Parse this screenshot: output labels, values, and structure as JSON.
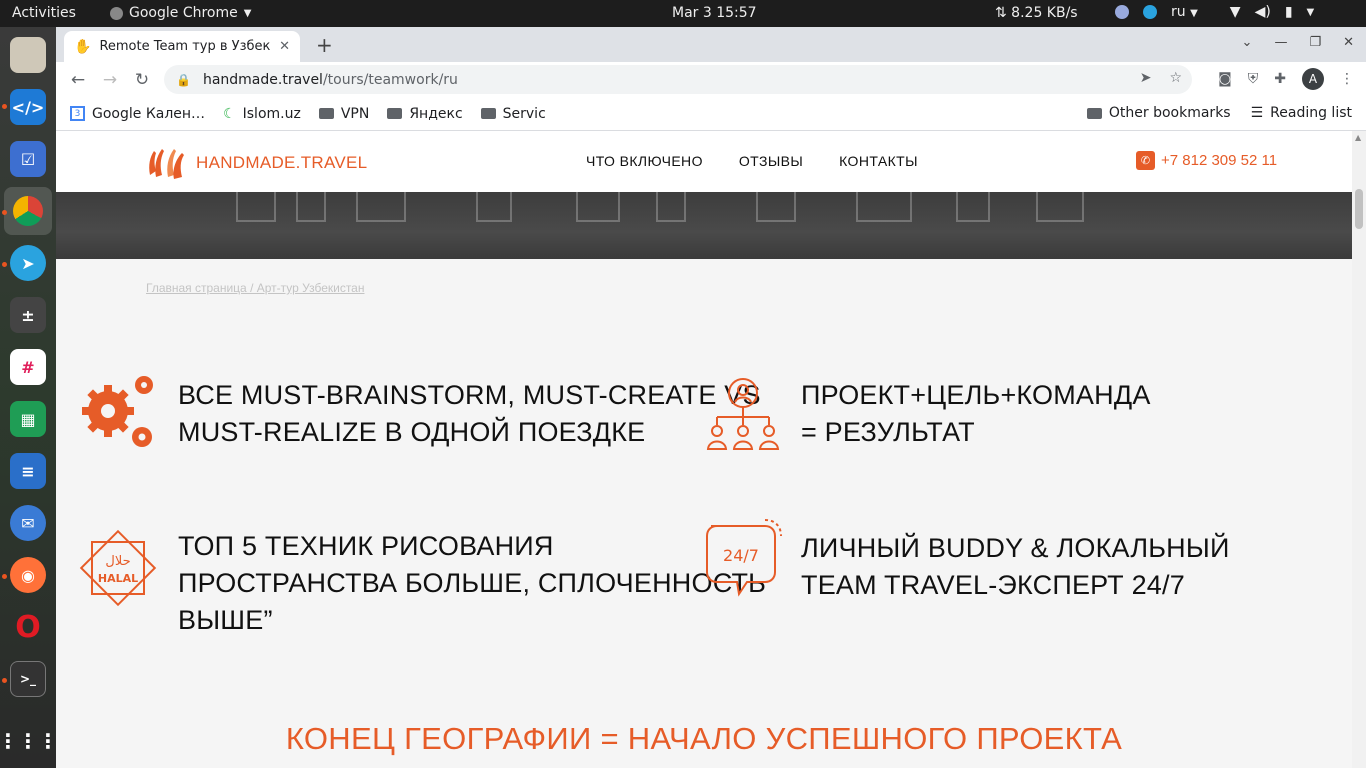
{
  "topbar": {
    "activities": "Activities",
    "app_name": "Google Chrome",
    "clock": "Mar 3  15:57",
    "net_speed": "⇅ 8.25 KB/s",
    "lang": "ru"
  },
  "tab": {
    "title": "Remote Team тур в Узбек"
  },
  "omnibox": {
    "host": "handmade.travel",
    "path": "/tours/teamwork/ru"
  },
  "profile_initial": "A",
  "bookmarks": {
    "items": [
      "Google Кален…",
      "Islom.uz",
      "VPN",
      "Яндекс",
      "Servic"
    ],
    "other": "Other bookmarks",
    "reading": "Reading list"
  },
  "site": {
    "logo": "HANDMADE.TRAVEL",
    "nav": [
      "ЧТО ВКЛЮЧЕНО",
      "ОТЗЫВЫ",
      "КОНТАКТЫ"
    ],
    "phone": "+7 812 309 52 11",
    "breadcrumb": "Главная страница / Арт-тур Узбекистан",
    "features": [
      "ВСЕ MUST-BRAINSTORM, MUST-CREATE VS\nMUST-REALIZE В ОДНОЙ ПОЕЗДКЕ",
      "ПРОЕКТ+ЦЕЛЬ+КОМАНДА\n= РЕЗУЛЬТАТ",
      "ТОП 5 ТЕХНИК РИСОВАНИЯ\nПРОСТРАНСТВА БОЛЬШЕ, СПЛОЧЕННОСТЬ\nВЫШЕ”",
      "ЛИЧНЫЙ BUDDY & ЛОКАЛЬНЫЙ\nTEAM TRAVEL-ЭКСПЕРТ 24/7"
    ],
    "halal_label": "HALAL",
    "halal_arabic": "حلال",
    "support_label": "24/7",
    "bottom_title": "КОНЕЦ ГЕОГРАФИИ = НАЧАЛО УСПЕШНОГО ПРОЕКТА"
  },
  "colors": {
    "accent": "#e65c28"
  }
}
